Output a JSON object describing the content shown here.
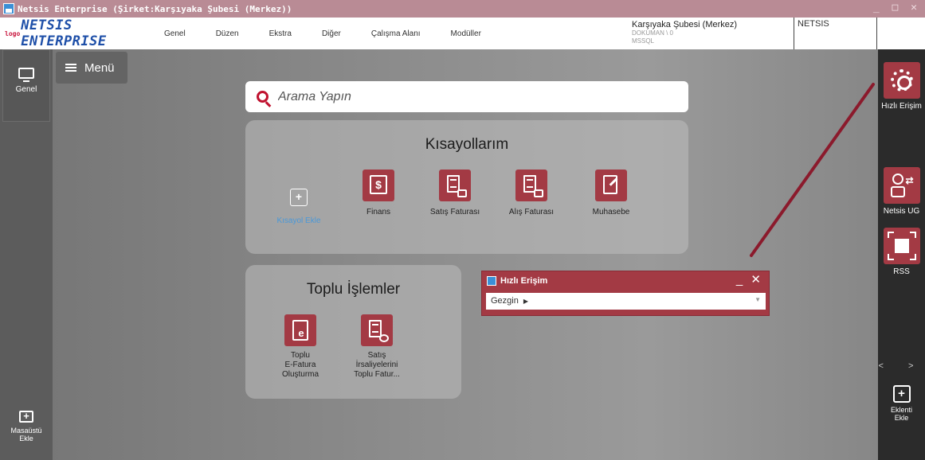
{
  "window": {
    "title": "Netsis Enterprise (Şirket:Karşıyaka Şubesi (Merkez))",
    "controls": "_ □ ✕"
  },
  "menubar": {
    "logo_small": "logo",
    "logo_text": "NETSIS ENTERPRISE",
    "items": [
      "Genel",
      "Düzen",
      "Ekstra",
      "Diğer",
      "Çalışma Alanı",
      "Modüller"
    ],
    "company_name": "Karşıyaka Şubesi (Merkez)",
    "company_db": "DOKUMAN \\ 0",
    "company_server": "MSSQL",
    "product_tag": "NETSIS"
  },
  "leftbar": {
    "genel_label": "Genel",
    "desktop_add_label_1": "Masaüstü",
    "desktop_add_label_2": "Ekle",
    "desktop_add_symbol": "+"
  },
  "menu_button": {
    "label": "Menü"
  },
  "search": {
    "placeholder": "Arama Yapın"
  },
  "shortcuts": {
    "title": "Kısayollarım",
    "add_label": "Kısayol Ekle",
    "add_symbol": "+",
    "items": [
      {
        "label": "Finans",
        "icon": "bank-icon"
      },
      {
        "label": "Satış Faturası",
        "icon": "sales-invoice-icon"
      },
      {
        "label": "Alış Faturası",
        "icon": "purchase-invoice-icon"
      },
      {
        "label": "Muhasebe",
        "icon": "ledger-icon"
      }
    ]
  },
  "bulk": {
    "title": "Toplu İşlemler",
    "items": [
      {
        "line1": "Toplu",
        "line2": "E-Fatura",
        "line3": "Oluşturma"
      },
      {
        "line1": "Satış",
        "line2": "İrsaliyelerini",
        "line3": "Toplu Fatur..."
      }
    ]
  },
  "quick_access": {
    "title": "Hızlı Erişim",
    "controls": "_ ✕",
    "field_value": "Gezgin",
    "caret": "▶",
    "dropdown": "▼"
  },
  "rightbar": {
    "items": [
      {
        "label": "Hızlı Erişim",
        "icon": "gear-icon"
      },
      {
        "label": "Netsis UG",
        "icon": "user-swap-icon"
      },
      {
        "label": "RSS",
        "icon": "expand-icon"
      }
    ],
    "nav": "< >",
    "add_symbol": "+",
    "add_label_1": "Eklenti",
    "add_label_2": "Ekle"
  },
  "colors": {
    "accent": "#a33a44",
    "titlebar": "#b98b95",
    "annotation": "#8b1a2c"
  }
}
